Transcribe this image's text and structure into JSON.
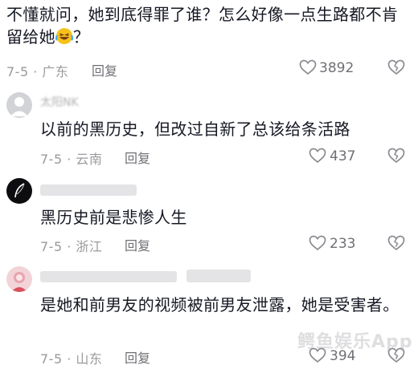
{
  "comments": [
    {
      "text_before_emoji": "不懂就问，她到底得罪了谁？怎么好像一点生路都不肯留给她",
      "text_after_emoji": "？",
      "emoji": "laughing-crying-emoji",
      "date_location": "7-5 · 广东",
      "reply_label": "回复",
      "like_count": "3892"
    },
    {
      "username": "太阳NK",
      "text": "以前的黑历史，但改过自新了总该给条活路",
      "date_location": "7-5 · 云南",
      "reply_label": "回复",
      "like_count": "437"
    },
    {
      "text": "黑历史前是悲惨人生",
      "date_location": "7-5 · 浙江",
      "reply_label": "回复",
      "like_count": "233"
    },
    {
      "text": "是她和前男友的视频被前男友泄露，她是受害者。",
      "date_location": "7-5 · 山东",
      "reply_label": "回复",
      "like_count": "394"
    }
  ],
  "watermark": "鳄鱼娱乐App",
  "colors": {
    "text": "#161823",
    "meta": "#9a9a9e",
    "icon": "#8a8b91"
  }
}
